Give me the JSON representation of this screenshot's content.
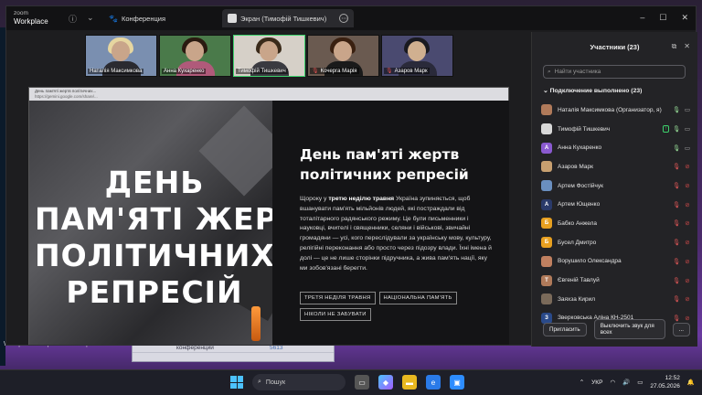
{
  "zoom": {
    "app_name": "zoom",
    "app_sub": "Workplace",
    "tab_meeting": "Конференция",
    "tab_screen": "Экран (Тимофій Тишкевич)"
  },
  "videos": [
    {
      "name": "Наталія Максимкова",
      "muted": false
    },
    {
      "name": "Анна Кухаренко",
      "muted": false
    },
    {
      "name": "Тимофій Тишкевич",
      "muted": false
    },
    {
      "name": "Кочерга Марія",
      "muted": true
    },
    {
      "name": "Азаров Марк",
      "muted": true
    }
  ],
  "browser": {
    "tab_title": "День пам'яті жертв політичних...",
    "url": "https://gemini.google.com/share/..."
  },
  "slide": {
    "big_title_lines": [
      "ДЕНЬ",
      "ПАМ'ЯТІ ЖЕРТВ",
      "ПОЛІТИЧНИХ",
      "РЕПРЕСІЙ"
    ],
    "heading": "День пам'яті жертв політичних репресій",
    "para_before": "Щороку у ",
    "para_bold": "третю неділю травня",
    "para_after": " Україна зупиняється, щоб вшанувати пам'ять мільйонів людей, які постраждали від тоталітарного радянського режиму. Це були письменники і науковці, вчителі і священники, селяни і військові, звичайні громадяни — усі, кого переслідували за українську мову, культуру, релігійні переконання або просто через підозру влади. Їхні імена й долі — це не лише сторінки підручника, а жива пам'ять нації, яку ми зобов'язані берегти.",
    "tags": [
      "ТРЕТЯ НЕДІЛЯ ТРАВНЯ",
      "НАЦІОНАЛЬНА ПАМ'ЯТЬ",
      "НІКОЛИ НЕ ЗАБУВАТИ"
    ]
  },
  "panel": {
    "title": "Участники (23)",
    "search_placeholder": "Найти участника",
    "connected": "Подключение выполнено (23)",
    "participants": [
      {
        "name": "Наталія Максимкова (Организатор, я)",
        "avatar": "",
        "color": "#b07a5a",
        "mic": "on",
        "cam": "on"
      },
      {
        "name": "Тимофій Тишкевич",
        "avatar": "",
        "color": "#d8d8d8",
        "mic": "on",
        "cam": "on",
        "sharing": true
      },
      {
        "name": "Анна Кухаренко",
        "avatar": "A",
        "color": "#8a5ad0",
        "mic": "on",
        "cam": "on"
      },
      {
        "name": "Азаров Марк",
        "avatar": "",
        "color": "#c8a070",
        "mic": "off",
        "cam": "off"
      },
      {
        "name": "Артем Фостійчук",
        "avatar": "",
        "color": "#6a8fc0",
        "mic": "off",
        "cam": "off"
      },
      {
        "name": "Артем Ющенко",
        "avatar": "A",
        "color": "#2a3a6a",
        "mic": "off",
        "cam": "off"
      },
      {
        "name": "Бабко Анжела",
        "avatar": "Б",
        "color": "#e8a020",
        "mic": "off",
        "cam": "off"
      },
      {
        "name": "Бусел Дмитро",
        "avatar": "Б",
        "color": "#e8a020",
        "mic": "off",
        "cam": "off"
      },
      {
        "name": "Ворушило Олександра",
        "avatar": "",
        "color": "#c08060",
        "mic": "off",
        "cam": "off"
      },
      {
        "name": "Євгеній Тавлуй",
        "avatar": "Т",
        "color": "#b07a5a",
        "mic": "off",
        "cam": "off"
      },
      {
        "name": "Заяхза Кирил",
        "avatar": "",
        "color": "#7a6a5a",
        "mic": "off",
        "cam": "off"
      },
      {
        "name": "Зверковська Аліна КН-2501",
        "avatar": "З",
        "color": "#2a4a8a",
        "mic": "off",
        "cam": "off"
      }
    ],
    "invite": "Пригласить",
    "mute_all": "Выключить звук для всех",
    "more": "..."
  },
  "desktop": {
    "labels": [
      "Workplace",
      "екрана 2...",
      "екрана 2..."
    ],
    "bg_window_text": "конференции",
    "bg_window_num": "5613"
  },
  "taskbar": {
    "search": "Пошук",
    "lang": "УКР",
    "time": "12:52",
    "date": "27.05.2026"
  }
}
